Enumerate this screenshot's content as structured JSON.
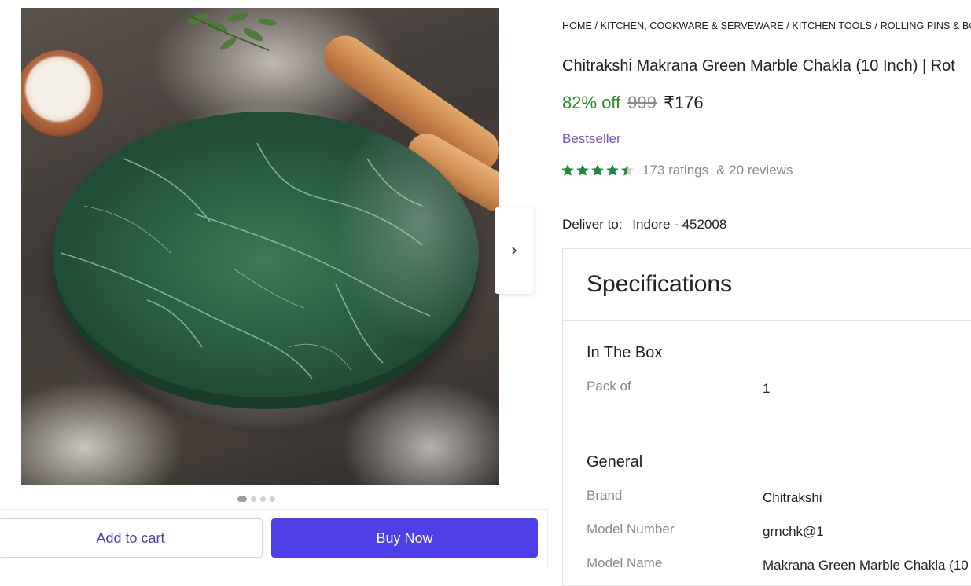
{
  "product": {
    "breadcrumb": [
      "HOME",
      "KITCHEN, COOKWARE & SERVEWARE",
      "KITCHEN TOOLS",
      "ROLLING PINS & BOA"
    ],
    "breadcrumb_separator": "/",
    "title": "Chitrakshi Makrana Green Marble Chakla (10 Inch) | Rot",
    "discount": "82% off",
    "mrp": "999",
    "price": "₹176",
    "badge": "Bestseller",
    "rating_value": 4.5,
    "ratings_text": "173 ratings",
    "reviews_text": "& 20 reviews",
    "deliver_label": "Deliver to:",
    "deliver_location": "Indore - 452008"
  },
  "gallery": {
    "image_icon": "marble-chakla-image",
    "next_icon": "chevron-right-icon",
    "dot_count": 4,
    "active_dot": 0
  },
  "actions": {
    "add_to_cart": "Add to cart",
    "buy_now": "Buy Now"
  },
  "specifications": {
    "title": "Specifications",
    "sections": [
      {
        "title": "In The Box",
        "rows": [
          {
            "key": "Pack of",
            "value": "1"
          }
        ]
      },
      {
        "title": "General",
        "rows": [
          {
            "key": "Brand",
            "value": "Chitrakshi"
          },
          {
            "key": "Model Number",
            "value": "grnchk@1"
          },
          {
            "key": "Model Name",
            "value": "Makrana Green Marble Chakla (10"
          }
        ]
      }
    ]
  },
  "colors": {
    "discount": "#2e8b2e",
    "bestseller": "#7b56c2",
    "buy_now_bg": "#4f3fe6",
    "star": "#1b8a3a"
  }
}
